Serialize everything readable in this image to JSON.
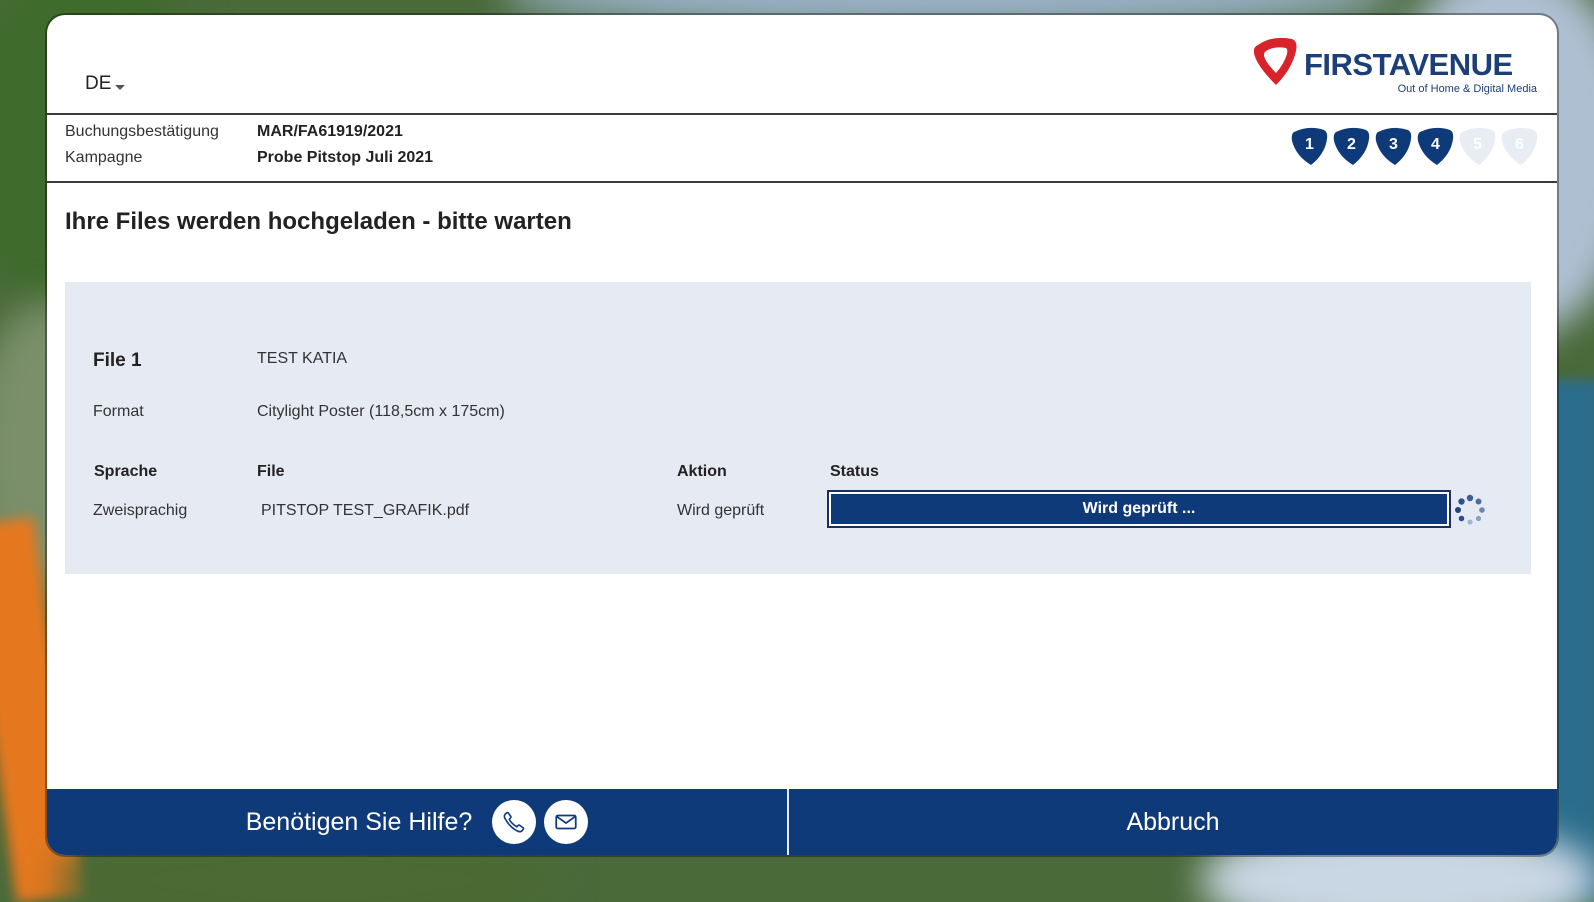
{
  "header": {
    "language": "DE",
    "logo": {
      "name": "FIRSTAVENUE",
      "tagline": "Out of Home & Digital Media"
    }
  },
  "booking": {
    "confirmation_label": "Buchungsbestätigung",
    "confirmation_value": "MAR/FA61919/2021",
    "campaign_label": "Kampagne",
    "campaign_value": "Probe Pitstop Juli 2021"
  },
  "steps": {
    "items": [
      "1",
      "2",
      "3",
      "4",
      "5",
      "6"
    ],
    "active_count": 4,
    "active_color": "#0e3a7a",
    "inactive_color": "#e8ecf3"
  },
  "main": {
    "title": "Ihre Files werden hochgeladen - bitte warten"
  },
  "file_panel": {
    "file_label": "File 1",
    "file_name": "TEST KATIA",
    "format_label": "Format",
    "format_value": "Citylight Poster (118,5cm x 175cm)",
    "columns": [
      "Sprache",
      "File",
      "Aktion",
      "Status"
    ],
    "row": {
      "sprache": "Zweisprachig",
      "file": "PITSTOP TEST_GRAFIK.pdf",
      "aktion": "Wird geprüft",
      "status": "Wird geprüft ..."
    }
  },
  "footer": {
    "help_text": "Benötigen Sie Hilfe?",
    "phone_icon": "phone-icon",
    "mail_icon": "mail-icon",
    "cancel_label": "Abbruch"
  },
  "colors": {
    "brand_blue": "#0e3a7a",
    "logo_red": "#d8232a",
    "panel_bg": "#e6eaf3"
  }
}
